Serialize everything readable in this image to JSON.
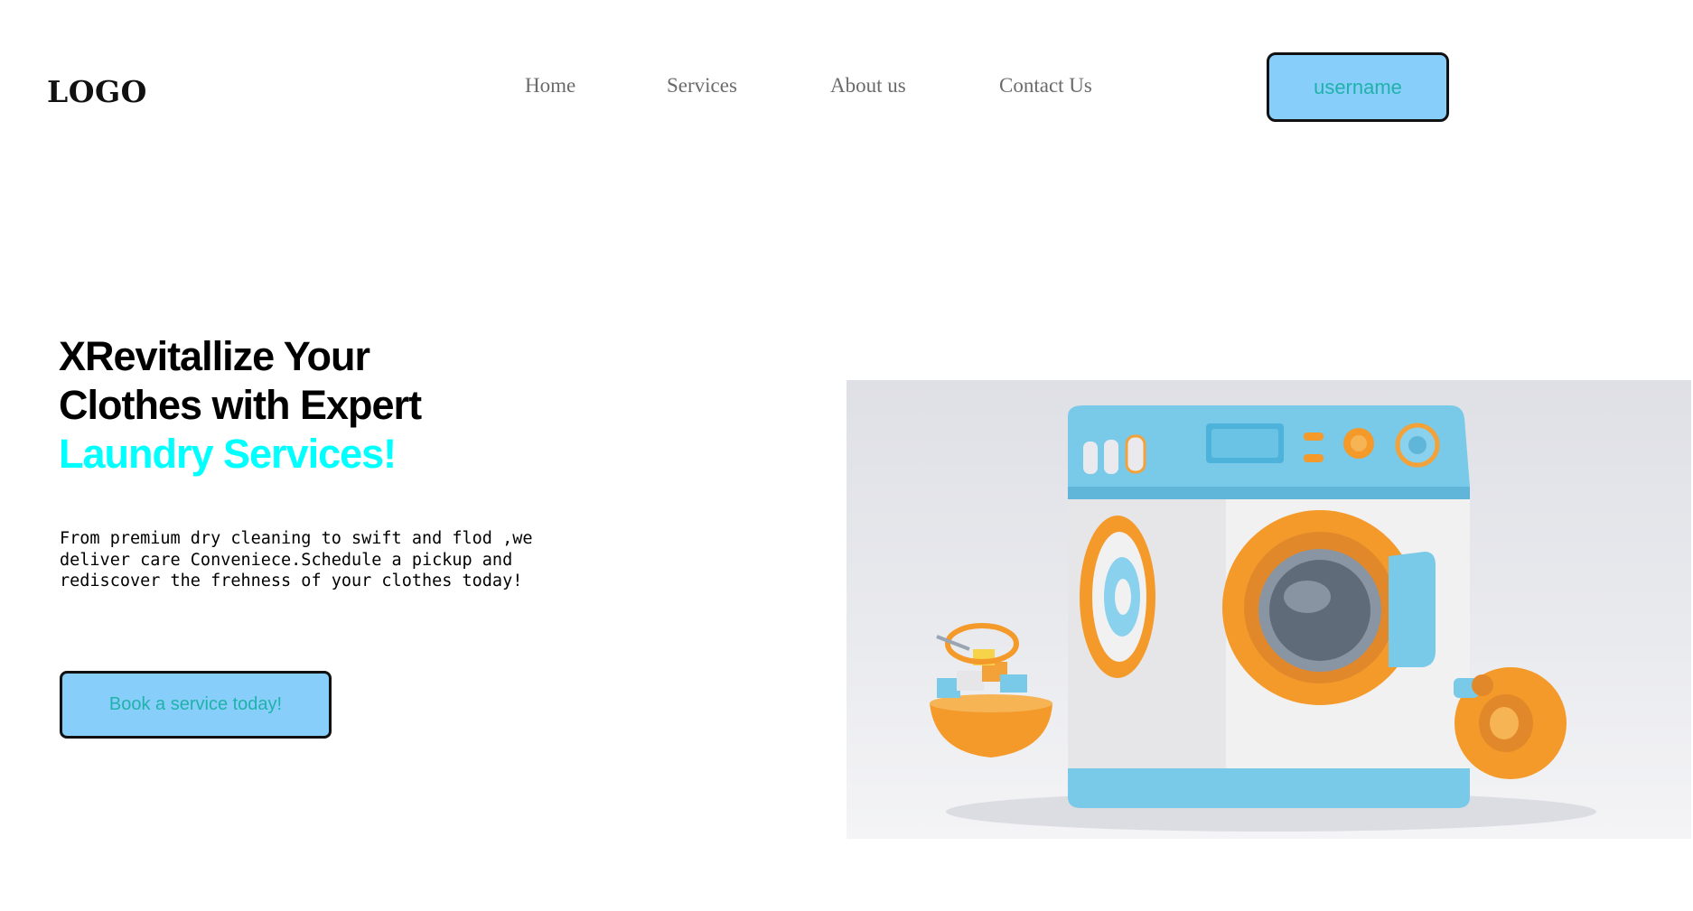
{
  "header": {
    "logo": "LOGO",
    "nav": [
      {
        "label": "Home"
      },
      {
        "label": "Services"
      },
      {
        "label": "About us"
      },
      {
        "label": "Contact Us"
      }
    ],
    "user_button": "username"
  },
  "hero": {
    "title_line1": "XRevitallize Your",
    "title_line2": "Clothes with Expert",
    "title_accent": "Laundry Services!",
    "description": "From premium dry cleaning to swift and flod ,we deliver care Conveniece.Schedule a pickup and rediscover the frehness of your clothes today!",
    "cta": "Book a service today!"
  },
  "colors": {
    "button_bg": "#87cefa",
    "button_text": "#20b2aa",
    "accent": "#00ffff",
    "nav_text": "#6b6b6b"
  },
  "image": {
    "subject": "washing-machine-illustration"
  }
}
